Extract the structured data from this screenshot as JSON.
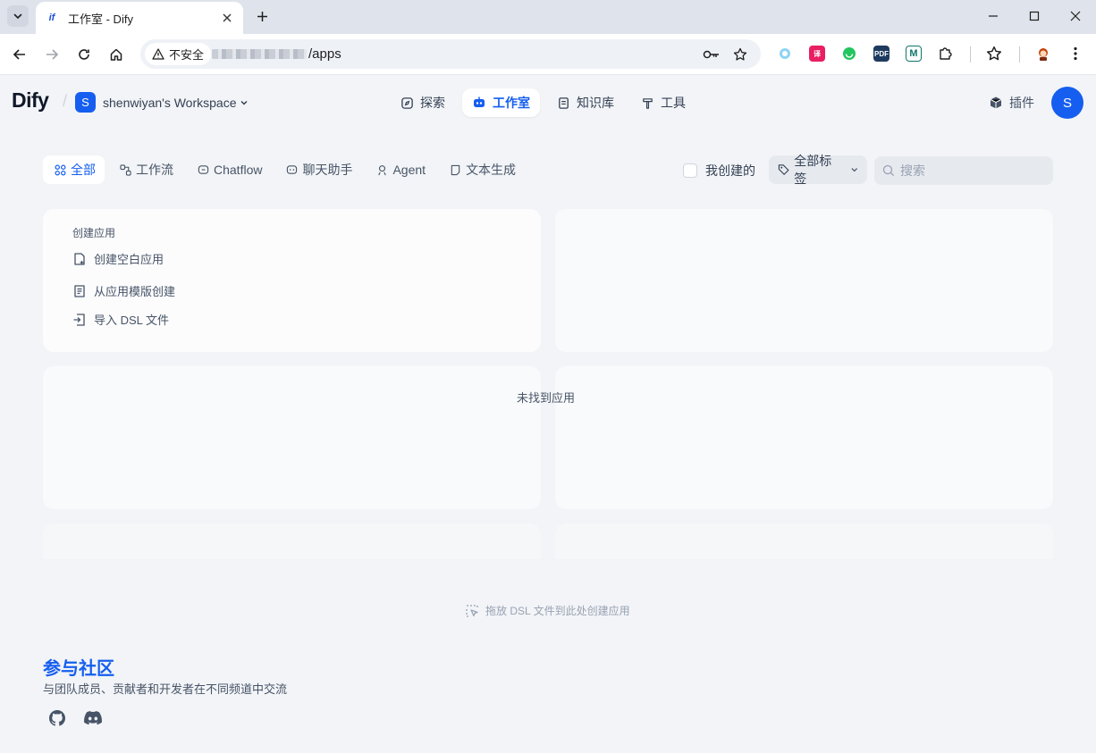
{
  "browser": {
    "tab_title": "工作室 - Dify",
    "favicon_text": "if",
    "security_label": "不安全",
    "url_path": "/apps"
  },
  "header": {
    "logo": "Dify",
    "workspace_initial": "S",
    "workspace_name": "shenwiyan's Workspace",
    "nav": [
      {
        "label": "探索",
        "icon": "compass-icon"
      },
      {
        "label": "工作室",
        "icon": "robot-icon"
      },
      {
        "label": "知识库",
        "icon": "book-icon"
      },
      {
        "label": "工具",
        "icon": "hammer-icon"
      }
    ],
    "plugins_label": "插件",
    "user_initial": "S"
  },
  "filters": {
    "tabs": [
      {
        "label": "全部",
        "icon": "grid-icon"
      },
      {
        "label": "工作流",
        "icon": "workflow-icon"
      },
      {
        "label": "Chatflow",
        "icon": "chatflow-icon"
      },
      {
        "label": "聊天助手",
        "icon": "chat-bot-icon"
      },
      {
        "label": "Agent",
        "icon": "agent-icon"
      },
      {
        "label": "文本生成",
        "icon": "text-gen-icon"
      }
    ],
    "mine_label": "我创建的",
    "tags_label": "全部标签",
    "search_placeholder": "搜索"
  },
  "create": {
    "title": "创建应用",
    "blank": "创建空白应用",
    "template": "从应用模版创建",
    "import_dsl": "导入 DSL 文件"
  },
  "empty_message": "未找到应用",
  "drop_hint": "拖放 DSL 文件到此处创建应用",
  "community": {
    "title": "参与社区",
    "description": "与团队成员、贡献者和开发者在不同频道中交流"
  },
  "colors": {
    "accent": "#155eef",
    "page_bg": "#f2f4f7"
  }
}
